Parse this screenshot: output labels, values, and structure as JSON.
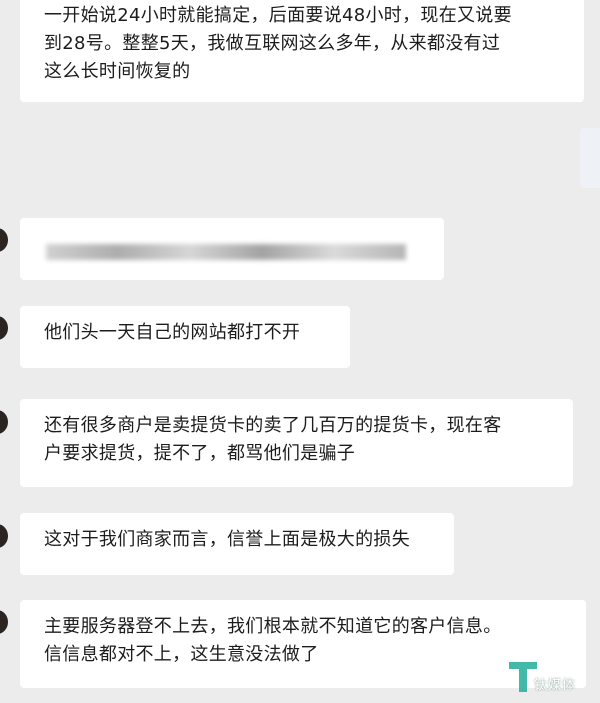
{
  "messages": [
    {
      "text": "一开始说24小时就能搞定，后面要说48小时，现在又说要\n到28号。整整5天，我做互联网这么多年，从来都没有过\n这么长时间恢复的"
    },
    {
      "text": ""
    },
    {
      "text": "他们头一天自己的网站都打不开"
    },
    {
      "text": "还有很多商户是卖提货卡的卖了几百万的提货卡，现在客\n户要求提货，提不了，都骂他们是骗子"
    },
    {
      "text": "这对于我们商家而言，信誉上面是极大的损失"
    },
    {
      "text": "主要服务器登不上去，我们根本就不知道它的客户信息。\n信信息都对不上，这生意没法做了"
    }
  ],
  "watermark": {
    "text": "钛媒体",
    "color": "#2fb3a0"
  }
}
